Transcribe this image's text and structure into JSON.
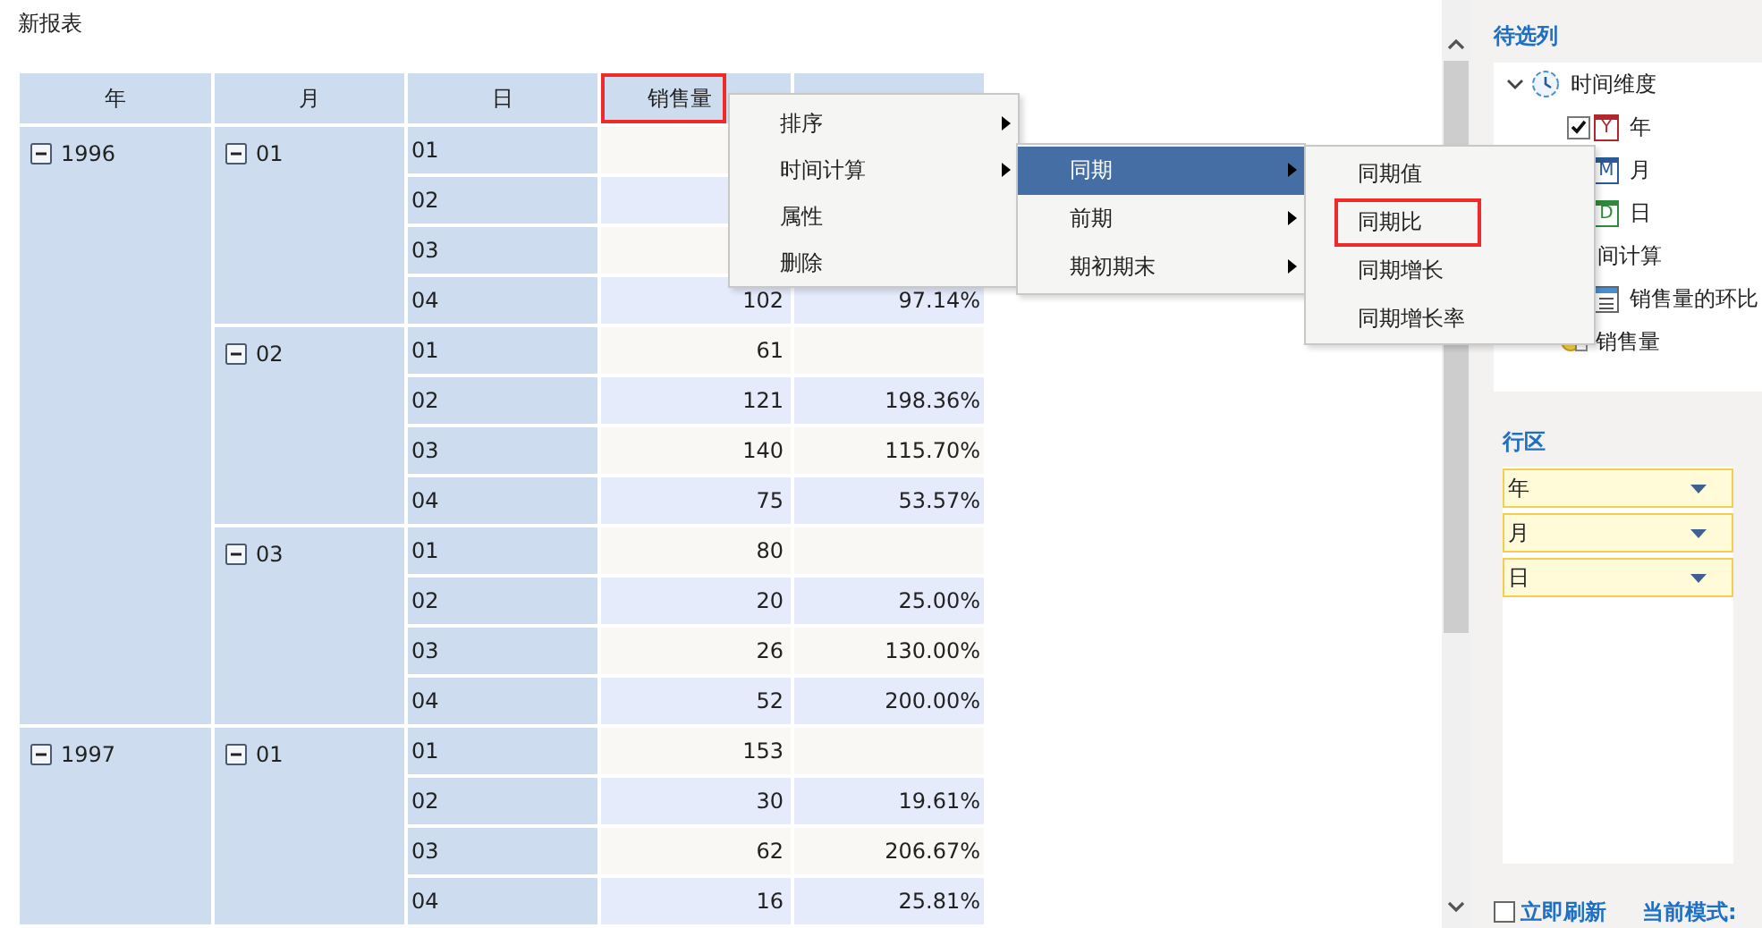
{
  "report": {
    "title": "新报表"
  },
  "table": {
    "columns": [
      {
        "label": "年",
        "highlighted": false
      },
      {
        "label": "月",
        "highlighted": false
      },
      {
        "label": "日",
        "highlighted": false
      },
      {
        "label": "销售量",
        "highlighted": true
      },
      {
        "highlighted": false
      }
    ],
    "years": [
      {
        "label": "1996",
        "expanded": true,
        "months": [
          {
            "label": "01",
            "expanded": true,
            "days": [
              {
                "day": "01"
              },
              {
                "day": "02"
              },
              {
                "day": "03"
              },
              {
                "day": "04",
                "sales": "102",
                "ratio": "97.14%"
              }
            ]
          },
          {
            "label": "02",
            "expanded": true,
            "days": [
              {
                "day": "01",
                "sales": "61"
              },
              {
                "day": "02",
                "sales": "121",
                "ratio": "198.36%"
              },
              {
                "day": "03",
                "sales": "140",
                "ratio": "115.70%"
              },
              {
                "day": "04",
                "sales": "75",
                "ratio": "53.57%"
              }
            ]
          },
          {
            "label": "03",
            "expanded": true,
            "days": [
              {
                "day": "01",
                "sales": "80"
              },
              {
                "day": "02",
                "sales": "20",
                "ratio": "25.00%"
              },
              {
                "day": "03",
                "sales": "26",
                "ratio": "130.00%"
              },
              {
                "day": "04",
                "sales": "52",
                "ratio": "200.00%"
              }
            ]
          }
        ]
      },
      {
        "label": "1997",
        "expanded": true,
        "months": [
          {
            "label": "01",
            "expanded": true,
            "days": [
              {
                "day": "01",
                "sales": "153"
              },
              {
                "day": "02",
                "sales": "30",
                "ratio": "19.61%"
              },
              {
                "day": "03",
                "sales": "62",
                "ratio": "206.67%"
              },
              {
                "day": "04",
                "sales": "16",
                "ratio": "25.81%"
              }
            ]
          }
        ]
      }
    ]
  },
  "context_menu": [
    {
      "label": "排序",
      "has_submenu": true
    },
    {
      "label": "时间计算",
      "has_submenu": true
    },
    {
      "label": "属性",
      "has_submenu": false
    },
    {
      "label": "删除",
      "has_submenu": false
    }
  ],
  "submenu": [
    {
      "label": "同期",
      "has_submenu": true,
      "selected": true
    },
    {
      "label": "前期",
      "has_submenu": true,
      "selected": false
    },
    {
      "label": "期初期末",
      "has_submenu": true,
      "selected": false
    }
  ],
  "submenu_2": [
    {
      "label": "同期值",
      "highlighted": false
    },
    {
      "label": "同期比",
      "highlighted": true
    },
    {
      "label": "同期增长",
      "highlighted": false
    },
    {
      "label": "同期增长率",
      "highlighted": false
    }
  ],
  "panel": {
    "title": "待选列",
    "tree": [
      {
        "label": "时间维度",
        "kind": "dimension",
        "expanded": true,
        "children": [
          {
            "label": "年",
            "kind": "date",
            "badge": "Y",
            "color": "#b0282c",
            "checked": true
          },
          {
            "label": "月",
            "kind": "date",
            "badge": "M",
            "color": "#2c5a96"
          },
          {
            "label": "日",
            "kind": "date",
            "badge": "D",
            "color": "#2f8a3c"
          }
        ]
      },
      {
        "label": "间计算",
        "kind": "group",
        "children": [
          {
            "label": "销售量的环比",
            "kind": "calc"
          }
        ]
      },
      {
        "label": "销售量",
        "kind": "measure"
      }
    ],
    "row_area": {
      "title": "行区",
      "items": [
        {
          "label": "年"
        },
        {
          "label": "月"
        },
        {
          "label": "日"
        }
      ]
    },
    "auto_refresh": {
      "label": "立即刷新",
      "checked": false
    },
    "mode": "当前模式:"
  }
}
